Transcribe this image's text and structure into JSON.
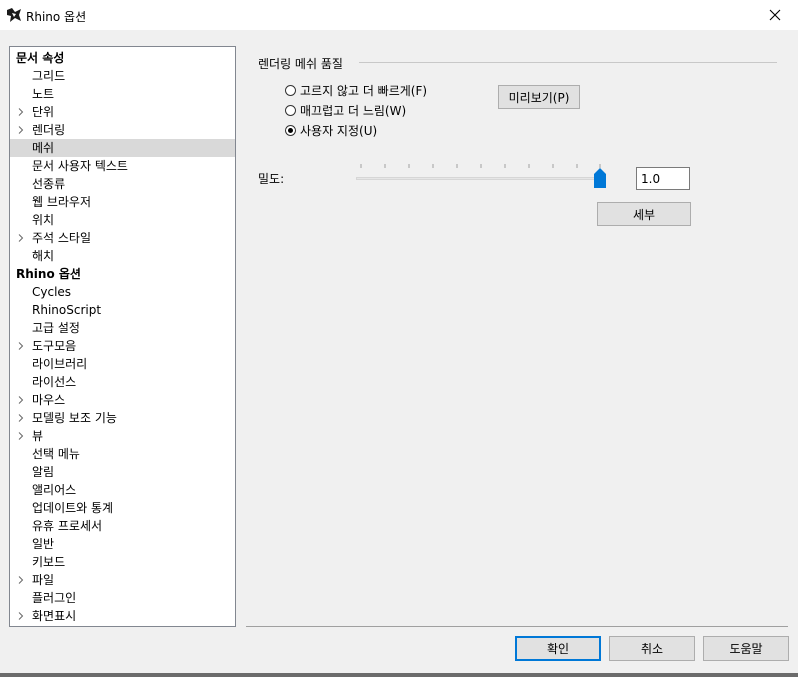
{
  "window": {
    "title": "Rhino 옵션"
  },
  "tree": {
    "items": [
      {
        "label": "문서 속성",
        "header": true
      },
      {
        "label": "그리드"
      },
      {
        "label": "노트"
      },
      {
        "label": "단위",
        "expandable": true
      },
      {
        "label": "렌더링",
        "expandable": true
      },
      {
        "label": "메쉬",
        "selected": true
      },
      {
        "label": "문서 사용자 텍스트"
      },
      {
        "label": "선종류"
      },
      {
        "label": "웹 브라우저"
      },
      {
        "label": "위치"
      },
      {
        "label": "주석 스타일",
        "expandable": true
      },
      {
        "label": "해치"
      },
      {
        "label": "Rhino 옵션",
        "header": true
      },
      {
        "label": "Cycles"
      },
      {
        "label": "RhinoScript"
      },
      {
        "label": "고급 설정"
      },
      {
        "label": "도구모음",
        "expandable": true
      },
      {
        "label": "라이브러리"
      },
      {
        "label": "라이선스"
      },
      {
        "label": "마우스",
        "expandable": true
      },
      {
        "label": "모델링 보조 기능",
        "expandable": true
      },
      {
        "label": "뷰",
        "expandable": true
      },
      {
        "label": "선택 메뉴"
      },
      {
        "label": "알림"
      },
      {
        "label": "앨리어스"
      },
      {
        "label": "업데이트와 통계"
      },
      {
        "label": "유휴 프로세서"
      },
      {
        "label": "일반"
      },
      {
        "label": "키보드"
      },
      {
        "label": "파일",
        "expandable": true
      },
      {
        "label": "플러그인"
      },
      {
        "label": "화면표시",
        "expandable": true
      }
    ]
  },
  "mesh": {
    "group_title": "렌더링 메쉬 품질",
    "options": [
      {
        "label": "고르지 않고 더 빠르게(F)",
        "checked": false
      },
      {
        "label": "매끄럽고 더 느림(W)",
        "checked": false
      },
      {
        "label": "사용자 지정(U)",
        "checked": true
      }
    ],
    "preview_button": "미리보기(P)",
    "density_label": "밀도:",
    "density_value": "1.0",
    "density_fraction": 1.0,
    "details_button": "세부"
  },
  "footer": {
    "ok": "확인",
    "cancel": "취소",
    "help": "도움말"
  },
  "colors": {
    "accent": "#0078d7",
    "selection": "#d9d9d9"
  }
}
